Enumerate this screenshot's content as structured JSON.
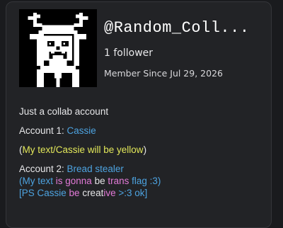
{
  "profile": {
    "handle": "@Random_Coll...",
    "followers": "1 follower",
    "member_since": "Member Since Jul 29, 2026"
  },
  "bio": {
    "line1": "Just a collab account",
    "account1": {
      "label": "Account 1: ",
      "name": "Cassie"
    },
    "yellow_note": {
      "open": "(",
      "text": "My text/Cassie will be yellow",
      "close": ")"
    },
    "account2": {
      "label": "Account 2: ",
      "name": "Bread stealer"
    },
    "trans_line": [
      {
        "text": "(My text ",
        "color": "blue"
      },
      {
        "text": "is gonna ",
        "color": "pink"
      },
      {
        "text": "be ",
        "color": "white"
      },
      {
        "text": "trans ",
        "color": "pink"
      },
      {
        "text": "flag :3)",
        "color": "blue"
      }
    ],
    "ps_line": [
      {
        "text": "[PS Cassie ",
        "color": "blue"
      },
      {
        "text": "be ",
        "color": "pink"
      },
      {
        "text": "creat",
        "color": "white"
      },
      {
        "text": "ive ",
        "color": "pink"
      },
      {
        "text": ">:3 ok]",
        "color": "blue"
      }
    ]
  },
  "colors": {
    "blue": "#4da3e0",
    "yellow": "#e3e85a",
    "pink": "#e37ad8",
    "white": "#e6e6e8",
    "card_bg": "#222326"
  },
  "icons": {
    "avatar": "pixel-art-character-avatar"
  }
}
